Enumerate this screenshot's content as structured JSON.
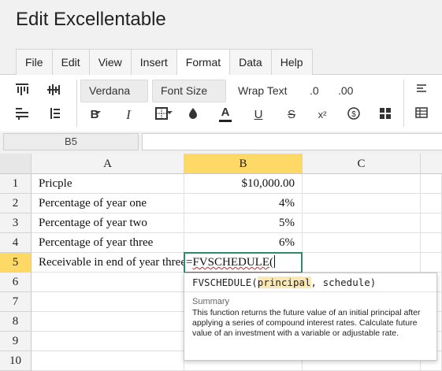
{
  "app": {
    "title": "Edit Excellentable"
  },
  "menu": {
    "tabs": [
      {
        "label": "File"
      },
      {
        "label": "Edit"
      },
      {
        "label": "View"
      },
      {
        "label": "Insert"
      },
      {
        "label": "Format",
        "active": true
      },
      {
        "label": "Data"
      },
      {
        "label": "Help"
      }
    ]
  },
  "toolbar": {
    "font_family": "Verdana",
    "font_size": "Font Size",
    "wrap_text": "Wrap Text",
    "decrease_decimal": ".0",
    "increase_decimal": ".00",
    "icons": [
      "align-top-icon",
      "align-middle-icon",
      "align-bottom-icon",
      "align-vertical-icon",
      "bold-icon",
      "italic-icon",
      "border-icon",
      "fill-color-icon",
      "font-color-icon",
      "underline-icon",
      "strikethrough-icon",
      "superscript-icon",
      "currency-icon",
      "merge-icon",
      "align-left-icon",
      "table-icon"
    ],
    "bold": "B",
    "italic": "I",
    "font_color": "A",
    "underline": "U",
    "strike": "S",
    "superscript": "x²",
    "currency": "$",
    "font_color_swatch": "#222222"
  },
  "formula_bar": {
    "cell_ref": "B5",
    "value": ""
  },
  "grid": {
    "columns": [
      "A",
      "B",
      "C"
    ],
    "selected_column": "B",
    "selected_row": "5",
    "rows": [
      {
        "num": "1",
        "a": "Pricple",
        "b": "$10,000.00"
      },
      {
        "num": "2",
        "a": "Percentage of year one",
        "b": "4%"
      },
      {
        "num": "3",
        "a": "Percentage of year two",
        "b": "5%"
      },
      {
        "num": "4",
        "a": "Percentage of year three",
        "b": "6%"
      },
      {
        "num": "5",
        "a": "Receivable in end of year three",
        "b": ""
      },
      {
        "num": "6",
        "a": "",
        "b": ""
      },
      {
        "num": "7",
        "a": "",
        "b": ""
      },
      {
        "num": "8",
        "a": "",
        "b": ""
      },
      {
        "num": "9",
        "a": "",
        "b": ""
      },
      {
        "num": "10",
        "a": "",
        "b": ""
      }
    ],
    "editing": {
      "prefix": "=",
      "function": "FVSCHEDULE",
      "suffix": "("
    }
  },
  "tooltip": {
    "signature_name": "FVSCHEDULE(",
    "signature_param": "principal",
    "signature_rest": ", schedule)",
    "summary_label": "Summary",
    "description": "This function returns the future value of an initial principal after applying a series of compound interest rates. Calculate future value of an investment with a variable or adjustable rate."
  },
  "colors": {
    "selected_header": "#ffd966",
    "edit_border": "#2e8b6e",
    "param_highlight": "#fce8b2"
  }
}
